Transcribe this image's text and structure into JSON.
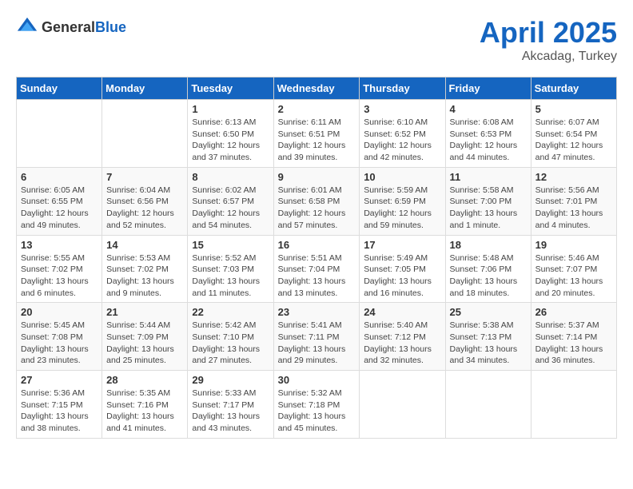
{
  "header": {
    "logo_general": "General",
    "logo_blue": "Blue",
    "month": "April 2025",
    "location": "Akcadag, Turkey"
  },
  "weekdays": [
    "Sunday",
    "Monday",
    "Tuesday",
    "Wednesday",
    "Thursday",
    "Friday",
    "Saturday"
  ],
  "weeks": [
    [
      {
        "day": "",
        "info": ""
      },
      {
        "day": "",
        "info": ""
      },
      {
        "day": "1",
        "info": "Sunrise: 6:13 AM\nSunset: 6:50 PM\nDaylight: 12 hours and 37 minutes."
      },
      {
        "day": "2",
        "info": "Sunrise: 6:11 AM\nSunset: 6:51 PM\nDaylight: 12 hours and 39 minutes."
      },
      {
        "day": "3",
        "info": "Sunrise: 6:10 AM\nSunset: 6:52 PM\nDaylight: 12 hours and 42 minutes."
      },
      {
        "day": "4",
        "info": "Sunrise: 6:08 AM\nSunset: 6:53 PM\nDaylight: 12 hours and 44 minutes."
      },
      {
        "day": "5",
        "info": "Sunrise: 6:07 AM\nSunset: 6:54 PM\nDaylight: 12 hours and 47 minutes."
      }
    ],
    [
      {
        "day": "6",
        "info": "Sunrise: 6:05 AM\nSunset: 6:55 PM\nDaylight: 12 hours and 49 minutes."
      },
      {
        "day": "7",
        "info": "Sunrise: 6:04 AM\nSunset: 6:56 PM\nDaylight: 12 hours and 52 minutes."
      },
      {
        "day": "8",
        "info": "Sunrise: 6:02 AM\nSunset: 6:57 PM\nDaylight: 12 hours and 54 minutes."
      },
      {
        "day": "9",
        "info": "Sunrise: 6:01 AM\nSunset: 6:58 PM\nDaylight: 12 hours and 57 minutes."
      },
      {
        "day": "10",
        "info": "Sunrise: 5:59 AM\nSunset: 6:59 PM\nDaylight: 12 hours and 59 minutes."
      },
      {
        "day": "11",
        "info": "Sunrise: 5:58 AM\nSunset: 7:00 PM\nDaylight: 13 hours and 1 minute."
      },
      {
        "day": "12",
        "info": "Sunrise: 5:56 AM\nSunset: 7:01 PM\nDaylight: 13 hours and 4 minutes."
      }
    ],
    [
      {
        "day": "13",
        "info": "Sunrise: 5:55 AM\nSunset: 7:02 PM\nDaylight: 13 hours and 6 minutes."
      },
      {
        "day": "14",
        "info": "Sunrise: 5:53 AM\nSunset: 7:02 PM\nDaylight: 13 hours and 9 minutes."
      },
      {
        "day": "15",
        "info": "Sunrise: 5:52 AM\nSunset: 7:03 PM\nDaylight: 13 hours and 11 minutes."
      },
      {
        "day": "16",
        "info": "Sunrise: 5:51 AM\nSunset: 7:04 PM\nDaylight: 13 hours and 13 minutes."
      },
      {
        "day": "17",
        "info": "Sunrise: 5:49 AM\nSunset: 7:05 PM\nDaylight: 13 hours and 16 minutes."
      },
      {
        "day": "18",
        "info": "Sunrise: 5:48 AM\nSunset: 7:06 PM\nDaylight: 13 hours and 18 minutes."
      },
      {
        "day": "19",
        "info": "Sunrise: 5:46 AM\nSunset: 7:07 PM\nDaylight: 13 hours and 20 minutes."
      }
    ],
    [
      {
        "day": "20",
        "info": "Sunrise: 5:45 AM\nSunset: 7:08 PM\nDaylight: 13 hours and 23 minutes."
      },
      {
        "day": "21",
        "info": "Sunrise: 5:44 AM\nSunset: 7:09 PM\nDaylight: 13 hours and 25 minutes."
      },
      {
        "day": "22",
        "info": "Sunrise: 5:42 AM\nSunset: 7:10 PM\nDaylight: 13 hours and 27 minutes."
      },
      {
        "day": "23",
        "info": "Sunrise: 5:41 AM\nSunset: 7:11 PM\nDaylight: 13 hours and 29 minutes."
      },
      {
        "day": "24",
        "info": "Sunrise: 5:40 AM\nSunset: 7:12 PM\nDaylight: 13 hours and 32 minutes."
      },
      {
        "day": "25",
        "info": "Sunrise: 5:38 AM\nSunset: 7:13 PM\nDaylight: 13 hours and 34 minutes."
      },
      {
        "day": "26",
        "info": "Sunrise: 5:37 AM\nSunset: 7:14 PM\nDaylight: 13 hours and 36 minutes."
      }
    ],
    [
      {
        "day": "27",
        "info": "Sunrise: 5:36 AM\nSunset: 7:15 PM\nDaylight: 13 hours and 38 minutes."
      },
      {
        "day": "28",
        "info": "Sunrise: 5:35 AM\nSunset: 7:16 PM\nDaylight: 13 hours and 41 minutes."
      },
      {
        "day": "29",
        "info": "Sunrise: 5:33 AM\nSunset: 7:17 PM\nDaylight: 13 hours and 43 minutes."
      },
      {
        "day": "30",
        "info": "Sunrise: 5:32 AM\nSunset: 7:18 PM\nDaylight: 13 hours and 45 minutes."
      },
      {
        "day": "",
        "info": ""
      },
      {
        "day": "",
        "info": ""
      },
      {
        "day": "",
        "info": ""
      }
    ]
  ]
}
